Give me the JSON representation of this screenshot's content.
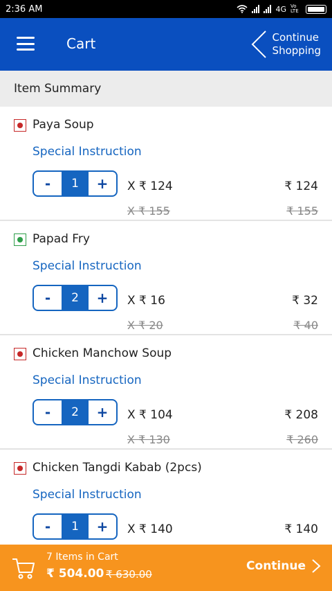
{
  "status": {
    "time": "2:36 AM",
    "network": "4G",
    "volte": "Vo LTE"
  },
  "header": {
    "title": "Cart",
    "continue_line1": "Continue",
    "continue_line2": "Shopping"
  },
  "summary_title": "Item Summary",
  "items": [
    {
      "name": "Paya Soup",
      "type": "nonveg",
      "special": "Special Instruction",
      "qty": "1",
      "minus": "-",
      "plus": "+",
      "unit_price": "X ₹ 124",
      "orig_unit": "X ₹ 155",
      "total": "₹ 124",
      "orig_total": "₹ 155"
    },
    {
      "name": "Papad Fry",
      "type": "veg",
      "special": "Special Instruction",
      "qty": "2",
      "minus": "-",
      "plus": "+",
      "unit_price": "X ₹ 16",
      "orig_unit": "X ₹ 20",
      "total": "₹ 32",
      "orig_total": "₹ 40"
    },
    {
      "name": "Chicken Manchow Soup",
      "type": "nonveg",
      "special": "Special Instruction",
      "qty": "2",
      "minus": "-",
      "plus": "+",
      "unit_price": "X ₹ 104",
      "orig_unit": "X ₹ 130",
      "total": "₹ 208",
      "orig_total": "₹ 260"
    },
    {
      "name": "Chicken Tangdi Kabab (2pcs)",
      "type": "nonveg",
      "special": "Special Instruction",
      "qty": "1",
      "minus": "-",
      "plus": "+",
      "unit_price": "X ₹ 140",
      "orig_unit": "",
      "total": "₹ 140",
      "orig_total": ""
    }
  ],
  "footer": {
    "count": "7 Items in Cart",
    "total": "₹ 504.00",
    "orig_total": "₹ 630.00",
    "continue": "Continue"
  },
  "colors": {
    "primary": "#0a4fbf",
    "accent": "#f7941e",
    "link": "#1565c0",
    "nonveg": "#c62828",
    "veg": "#2e9e49"
  },
  "icons": {
    "menu": "hamburger-icon",
    "back": "chevron-left-icon",
    "cart": "cart-icon",
    "next": "chevron-right-icon"
  }
}
